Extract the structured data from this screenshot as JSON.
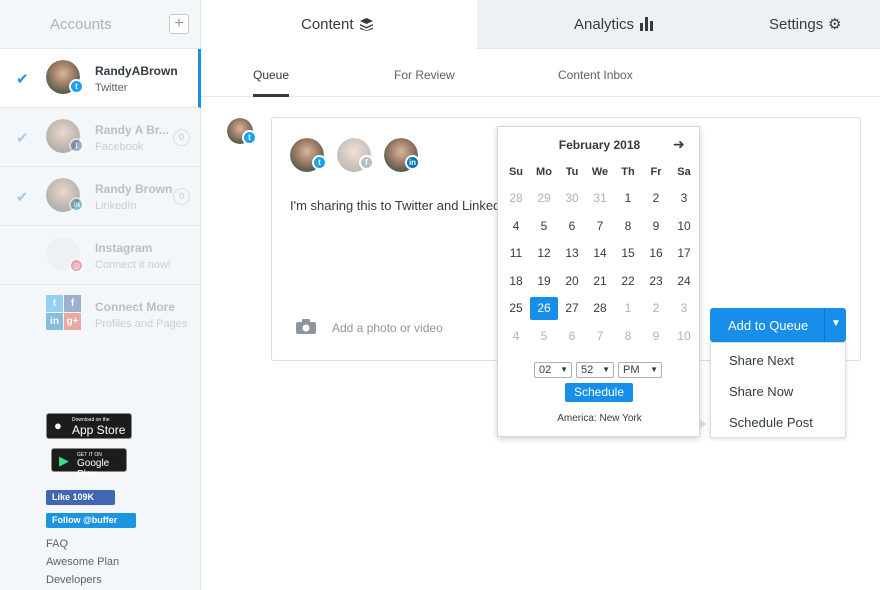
{
  "sidebar": {
    "title": "Accounts",
    "add_label": "+",
    "accounts": [
      {
        "name": "RandyABrown",
        "network": "Twitter",
        "count": ""
      },
      {
        "name": "Randy A Br...",
        "network": "Facebook",
        "count": "0"
      },
      {
        "name": "Randy Brown",
        "network": "LinkedIn",
        "count": "0"
      },
      {
        "name": "Instagram",
        "network": "Connect it now!",
        "count": ""
      },
      {
        "name": "Connect More",
        "network": "Profiles and Pages",
        "count": ""
      }
    ],
    "app_store": {
      "small": "Download on the",
      "big": "App Store"
    },
    "google_play": {
      "small": "GET IT ON",
      "big": "Google Play"
    },
    "fb_like": "Like 109K",
    "tw_follow": "Follow @buffer",
    "links": [
      "FAQ",
      "Awesome Plan",
      "Developers"
    ]
  },
  "tabs": {
    "content": "Content",
    "analytics": "Analytics",
    "settings": "Settings"
  },
  "subtabs": {
    "queue": "Queue",
    "review": "For Review",
    "inbox": "Content Inbox"
  },
  "composer": {
    "text": "I'm sharing this to Twitter and Linked",
    "photo_label": "Add a photo or video"
  },
  "queue_button": {
    "label": "Add to Queue",
    "options": [
      "Share Next",
      "Share Now",
      "Schedule Post"
    ]
  },
  "calendar": {
    "month": "February 2018",
    "weekdays": [
      "Su",
      "Mo",
      "Tu",
      "We",
      "Th",
      "Fr",
      "Sa"
    ],
    "weeks": [
      [
        "28",
        "29",
        "30",
        "31",
        "1",
        "2",
        "3"
      ],
      [
        "4",
        "5",
        "6",
        "7",
        "8",
        "9",
        "10"
      ],
      [
        "11",
        "12",
        "13",
        "14",
        "15",
        "16",
        "17"
      ],
      [
        "18",
        "19",
        "20",
        "21",
        "22",
        "23",
        "24"
      ],
      [
        "25",
        "26",
        "27",
        "28",
        "1",
        "2",
        "3"
      ],
      [
        "4",
        "5",
        "6",
        "7",
        "8",
        "9",
        "10"
      ]
    ],
    "selected_day": "26",
    "hour": "02",
    "minute": "52",
    "ampm": "PM",
    "schedule_label": "Schedule",
    "timezone": "America: New York"
  },
  "colors": {
    "accent": "#168eea",
    "twitter": "#1da1f2",
    "facebook": "#3b5998",
    "linkedin": "#0077b5",
    "instagram": "#e4405f"
  }
}
